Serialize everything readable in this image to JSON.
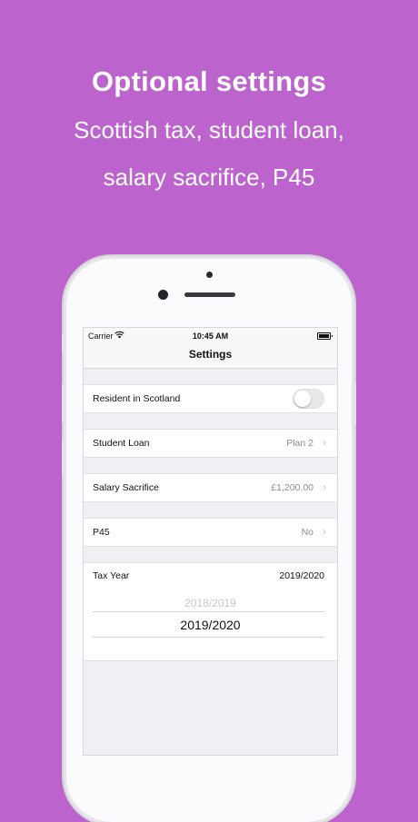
{
  "promo": {
    "headline": "Optional settings",
    "subline1": "Scottish tax, student loan,",
    "subline2": "salary sacrifice, P45",
    "background_color": "#bd63cd"
  },
  "statusbar": {
    "carrier": "Carrier",
    "time": "10:45 AM"
  },
  "navbar": {
    "title": "Settings"
  },
  "settings": {
    "scotland": {
      "label": "Resident in Scotland",
      "toggle_on": false
    },
    "student_loan": {
      "label": "Student Loan",
      "value": "Plan 2"
    },
    "salary_sacrifice": {
      "label": "Salary Sacrifice",
      "value": "£1,200.00"
    },
    "p45": {
      "label": "P45",
      "value": "No"
    },
    "tax_year": {
      "label": "Tax Year",
      "value": "2019/2020",
      "picker_options_visible": [
        "2018/2019",
        "2019/2020"
      ],
      "picker_selected": "2019/2020"
    }
  }
}
